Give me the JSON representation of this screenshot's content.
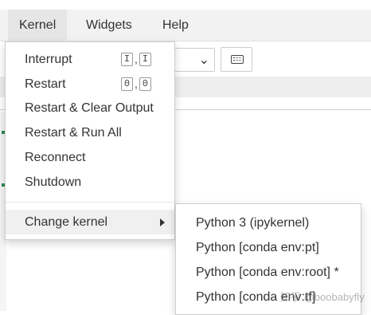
{
  "menubar": {
    "items": [
      {
        "label": "Kernel",
        "active": true
      },
      {
        "label": "Widgets"
      },
      {
        "label": "Help"
      }
    ]
  },
  "kernel_menu": {
    "items": [
      {
        "label": "Interrupt",
        "shortcut": [
          "I",
          "I"
        ]
      },
      {
        "label": "Restart",
        "shortcut": [
          "0",
          "0"
        ]
      },
      {
        "label": "Restart & Clear Output"
      },
      {
        "label": "Restart & Run All"
      },
      {
        "label": "Reconnect"
      },
      {
        "label": "Shutdown"
      },
      {
        "label": "Change kernel",
        "highlighted": true,
        "has_submenu": true
      }
    ]
  },
  "change_kernel_submenu": {
    "items": [
      {
        "label": "Python 3 (ipykernel)"
      },
      {
        "label": "Python [conda env:pt]"
      },
      {
        "label": "Python [conda env:root] *"
      },
      {
        "label": "Python [conda env:tf]"
      }
    ]
  },
  "toolbar": {
    "select_chevron_icon": "chevron-down-icon",
    "keyboard_icon": "keyboard-icon"
  },
  "watermark": "知乎 @boobabyfly",
  "colors": {
    "menubar_bg": "#f2f2f2",
    "highlight_bg": "#f0f0f0",
    "text": "#333333"
  }
}
